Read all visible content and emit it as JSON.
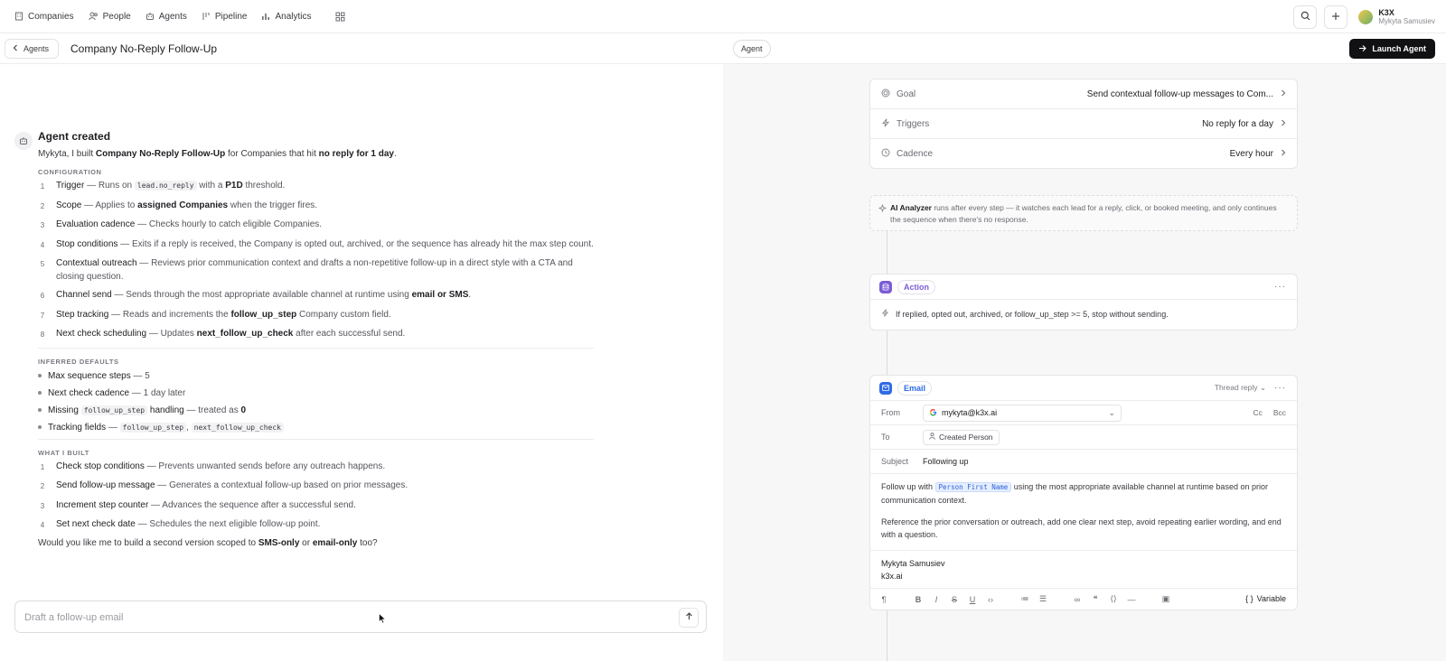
{
  "nav": {
    "items": [
      {
        "label": "Companies",
        "icon": "building-icon"
      },
      {
        "label": "People",
        "icon": "people-icon"
      },
      {
        "label": "Agents",
        "icon": "robot-icon"
      },
      {
        "label": "Pipeline",
        "icon": "pipeline-icon"
      },
      {
        "label": "Analytics",
        "icon": "bar-chart-icon"
      }
    ],
    "apps_icon": "grid-icon"
  },
  "user": {
    "org": "K3X",
    "name": "Mykyta Samusiev"
  },
  "subbar": {
    "back_label": "Agents",
    "title": "Company No-Reply Follow-Up",
    "agent_pill": "Agent",
    "launch_label": "Launch Agent"
  },
  "message": {
    "heading": "Agent created",
    "intro": {
      "a": "Mykyta, I built ",
      "b": "Company No-Reply Follow-Up",
      "c": " for Companies that hit ",
      "d": "no reply for 1 day",
      "e": "."
    },
    "config_label": "CONFIGURATION",
    "config": [
      {
        "num": "1",
        "title": "Trigger",
        "pre": " — Runs on ",
        "code": "lead.no_reply",
        "mid": " with a ",
        "bold": "P1D",
        "post": " threshold."
      },
      {
        "num": "2",
        "title": "Scope",
        "pre": " — Applies to ",
        "bold": "assigned Companies",
        "post": " when the trigger fires."
      },
      {
        "num": "3",
        "title": "Evaluation cadence",
        "post": " — Checks hourly to catch eligible Companies."
      },
      {
        "num": "4",
        "title": "Stop conditions",
        "post": " — Exits if a reply is received, the Company is opted out, archived, or the sequence has already hit the max step count."
      },
      {
        "num": "5",
        "title": "Contextual outreach",
        "post": " — Reviews prior communication context and drafts a non-repetitive follow-up in a direct style with a CTA and closing question."
      },
      {
        "num": "6",
        "title": "Channel send",
        "pre": " — Sends through the most appropriate available channel at runtime using ",
        "bold": "email or SMS",
        "post": "."
      },
      {
        "num": "7",
        "title": "Step tracking",
        "pre": " — Reads and increments the ",
        "bold": "follow_up_step",
        "post": " Company custom field."
      },
      {
        "num": "8",
        "title": "Next check scheduling",
        "pre": " — Updates ",
        "bold": "next_follow_up_check",
        "post": " after each successful send."
      }
    ],
    "defaults_label": "INFERRED DEFAULTS",
    "defaults": {
      "d1_title": "Max sequence steps",
      "d1_rest": " — 5",
      "d2_title": "Next check cadence",
      "d2_rest": " — 1 day later",
      "d3_title": "Missing ",
      "d3_code": "follow_up_step",
      "d3_title2": " handling",
      "d3_rest": " — treated as ",
      "d3_bold": "0",
      "d4_title": "Tracking fields",
      "d4_rest": " — ",
      "d4_code1": "follow_up_step",
      "d4_sep": ", ",
      "d4_code2": "next_follow_up_check"
    },
    "built_label": "WHAT I BUILT",
    "built": [
      {
        "num": "1",
        "title": "Check stop conditions",
        "post": " — Prevents unwanted sends before any outreach happens."
      },
      {
        "num": "2",
        "title": "Send follow-up message",
        "post": " — Generates a contextual follow-up based on prior messages."
      },
      {
        "num": "3",
        "title": "Increment step counter",
        "post": " — Advances the sequence after a successful send."
      },
      {
        "num": "4",
        "title": "Set next check date",
        "post": " — Schedules the next eligible follow-up point."
      }
    ],
    "closing": {
      "a": "Would you like me to build a second version scoped to ",
      "b": "SMS-only",
      "c": " or ",
      "d": "email-only",
      "e": " too?"
    }
  },
  "composer": {
    "placeholder": "Draft a follow-up email",
    "value": ""
  },
  "config_card": {
    "rows": [
      {
        "label": "Goal",
        "value": "Send contextual follow-up messages to Com...",
        "icon": "target-icon"
      },
      {
        "label": "Triggers",
        "value": "No reply for a day",
        "icon": "bolt-icon"
      },
      {
        "label": "Cadence",
        "value": "Every hour",
        "icon": "clock-icon"
      }
    ]
  },
  "analyzer": {
    "title": "AI Analyzer",
    "text": " runs after every step — it watches each lead for a reply, click, or booked meeting, and only continues the sequence when there's no response."
  },
  "action_step": {
    "tag": "Action",
    "condition": "If replied, opted out, archived, or follow_up_step >= 5, stop without sending."
  },
  "email_step": {
    "tag": "Email",
    "thread_mode": "Thread reply",
    "from_label": "From",
    "from_value": "mykyta@k3x.ai",
    "cc": "Cc",
    "bcc": "Bcc",
    "to_label": "To",
    "to_value": "Created Person",
    "subject_label": "Subject",
    "subject_value": "Following up",
    "body_p1_a": "Follow up with ",
    "body_var": "Person First Name",
    "body_p1_b": " using the most appropriate available channel at runtime based on prior communication context.",
    "body_p2": "Reference the prior conversation or outreach, add one clear next step, avoid repeating earlier wording, and end with a question.",
    "sig_name": "Mykyta Samusiev",
    "sig_domain": "k3x.ai",
    "variable_label": "Variable"
  },
  "colors": {
    "accent_dark": "#111114",
    "action_purple": "#7b5cd6",
    "email_blue": "#2e6be6",
    "var_blue": "#2b5fd9"
  }
}
